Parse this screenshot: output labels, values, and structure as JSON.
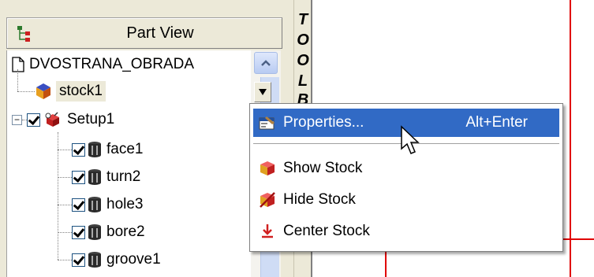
{
  "part_view": {
    "title": "Part View",
    "root": "DVOSTRANA_OBRADA",
    "stock": "stock1",
    "setup": "Setup1",
    "features": [
      {
        "label": "face1"
      },
      {
        "label": "turn2"
      },
      {
        "label": "hole3"
      },
      {
        "label": "bore2"
      },
      {
        "label": "groove1"
      }
    ]
  },
  "toolbar": {
    "letters": [
      "T",
      "O",
      "O",
      "L",
      "B"
    ]
  },
  "context_menu": {
    "items": [
      {
        "label": "Properties...",
        "shortcut": "Alt+Enter",
        "icon": "properties-icon"
      },
      {
        "label": "Show Stock",
        "icon": "show-stock-icon"
      },
      {
        "label": "Hide Stock",
        "icon": "hide-stock-icon"
      },
      {
        "label": "Center Stock",
        "icon": "center-stock-icon"
      }
    ]
  },
  "colors": {
    "highlight": "#316ac5",
    "canvas_line": "#e00000",
    "scroll": "#cfdcf5"
  }
}
